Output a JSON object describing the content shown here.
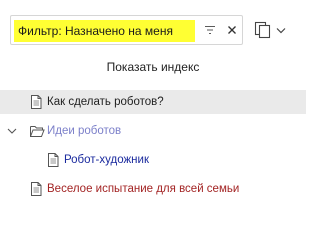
{
  "filter": {
    "value": "Фильтр: Назначено на меня",
    "highlight_color": "#ffff33",
    "filter_icon": "filter-lines-icon",
    "clear_icon": "close-icon"
  },
  "toolbar": {
    "pages_icon": "pages-stack-icon",
    "dropdown_icon": "chevron-down-icon"
  },
  "index_button": {
    "label": "Показать индекс"
  },
  "tree": {
    "items": [
      {
        "label": "Как сделать роботов?",
        "icon": "page-icon",
        "color": "#1f1f1f",
        "selected": true
      },
      {
        "label": "Идеи роботов",
        "icon": "folder-open-icon",
        "color": "#7b7fc9",
        "expanded": true
      },
      {
        "label": "Робот-художник",
        "icon": "page-icon",
        "color": "#1a2a9e"
      },
      {
        "label": "Веселое испытание для всей семьи",
        "icon": "page-icon",
        "color": "#a32424"
      }
    ]
  }
}
